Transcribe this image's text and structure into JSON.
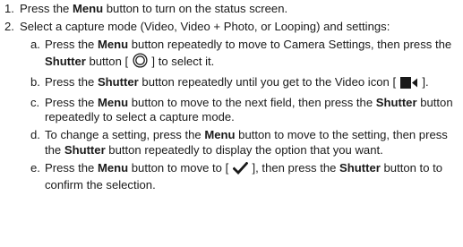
{
  "steps": [
    {
      "num": "1.",
      "parts": [
        "Press the ",
        "Menu",
        " button to turn on the status screen."
      ]
    },
    {
      "num": "2.",
      "text": "Select a capture mode (Video, Video + Photo, or Looping) and settings:",
      "substeps": [
        {
          "letter": "a.",
          "t1": "Press the ",
          "b1": "Menu",
          "t2": " button repeatedly  to move to Camera Settings, then press the ",
          "b2": "Shutter",
          "t3": " button [ ",
          "icon": "shutter-button-icon",
          "t4": " ] to select it."
        },
        {
          "letter": "b.",
          "t1": "Press the ",
          "b1": "Shutter",
          "t2": " button repeatedly until you get to the Video icon [ ",
          "icon": "video-camera-icon",
          "t3": " ]."
        },
        {
          "letter": "c.",
          "t1": "Press the ",
          "b1": "Menu",
          "t2": " button to move to the next field, then press the ",
          "b2": "Shutter",
          "t3": " button repeatedly to select a capture mode."
        },
        {
          "letter": "d.",
          "t1": "To change a setting, press the ",
          "b1": "Menu",
          "t2": " button to move to the setting, then press the ",
          "b2": "Shutter",
          "t3": " button repeatedly to display the option that you want."
        },
        {
          "letter": "e.",
          "t1": "Press the ",
          "b1": "Menu",
          "t2": " button to move to [ ",
          "icon": "checkmark-icon",
          "t3": " ], then press the ",
          "b2": "Shutter",
          "t4": " button to to confirm the selection."
        }
      ]
    }
  ]
}
